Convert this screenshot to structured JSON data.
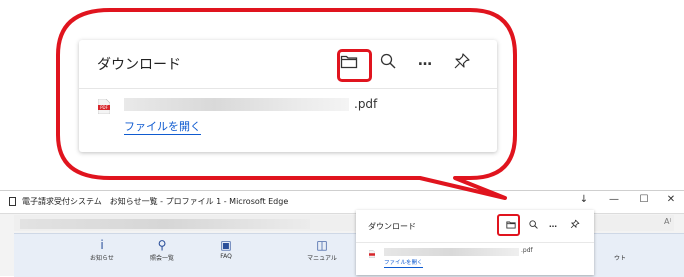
{
  "colors": {
    "callout_red": "#e0141e",
    "link_blue": "#0f5bd0"
  },
  "download_panel": {
    "title": "ダウンロード",
    "toolbar": [
      "folder-icon",
      "search-icon",
      "more-icon",
      "pin-icon"
    ],
    "more_label": "…",
    "item": {
      "file_ext": ".pdf",
      "open_link": "ファイルを開く",
      "file_icon": "pdf-file-icon"
    }
  },
  "browser": {
    "window_title": "電子請求受付システム　お知らせ一覧 - プロファイル 1 - Microsoft Edge",
    "window_controls": {
      "download": "↓",
      "minimize": "—",
      "maximize": "☐",
      "close": "✕"
    },
    "read_aloud": "A⁾",
    "nav_items": [
      {
        "label": "お知らせ",
        "icon": "info-icon"
      },
      {
        "label": "照会一覧",
        "icon": "magnifier-icon"
      },
      {
        "label": "FAQ",
        "icon": "faq-icon"
      },
      {
        "label": "マニュアル",
        "icon": "book-icon"
      }
    ],
    "hidden_nav_tail": "ウト"
  }
}
